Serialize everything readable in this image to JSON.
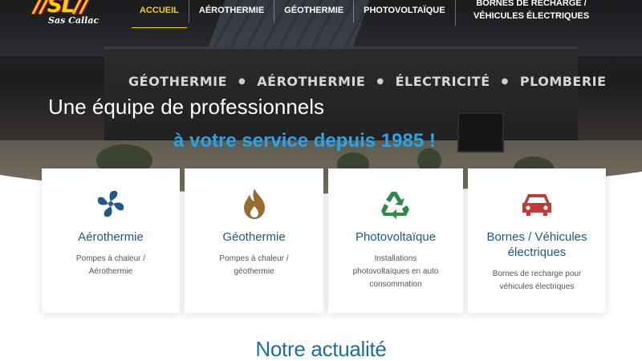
{
  "brand": {
    "mark": "//SL//",
    "sub": "Sas Callac",
    "accent": "#f5d20b"
  },
  "nav": {
    "items": [
      {
        "label": "ACCUEIL",
        "active": true
      },
      {
        "label": "AÉROTHERMIE"
      },
      {
        "label": "GÉOTHERMIE"
      },
      {
        "label": "PHOTOVOLTAÏQUE"
      },
      {
        "label": "BORNES DE RECHARGE / VÉHICULES ÉLECTRIQUES"
      }
    ]
  },
  "hero": {
    "sign": [
      "GÉOTHERMIE",
      "AÉROTHERMIE",
      "ÉLECTRICITÉ",
      "PLOMBERIE"
    ],
    "headline1": "Une équipe de professionnels",
    "headline2": "à votre service depuis 1985 !",
    "headline2_color": "#2aa4e6"
  },
  "cards": [
    {
      "icon": "fan-icon",
      "title": "Aérothermie",
      "desc": "Pompes à chaleur / Aérothermie",
      "icon_color": "#1d5a87"
    },
    {
      "icon": "flame-icon",
      "title": "Géothermie",
      "desc": "Pompes à chaleur / géothermie",
      "icon_color": "#9a6b2f"
    },
    {
      "icon": "recycle-icon",
      "title": "Photovoltaïque",
      "desc": "Installations photovoltaïques en auto consommation",
      "icon_color": "#2f8a4a"
    },
    {
      "icon": "car-icon",
      "title": "Bornes / Véhicules électriques",
      "desc": "Bornes de recharge pour véhicules électriques",
      "icon_color": "#c0393b"
    }
  ],
  "news": {
    "title": "Notre actualité"
  }
}
